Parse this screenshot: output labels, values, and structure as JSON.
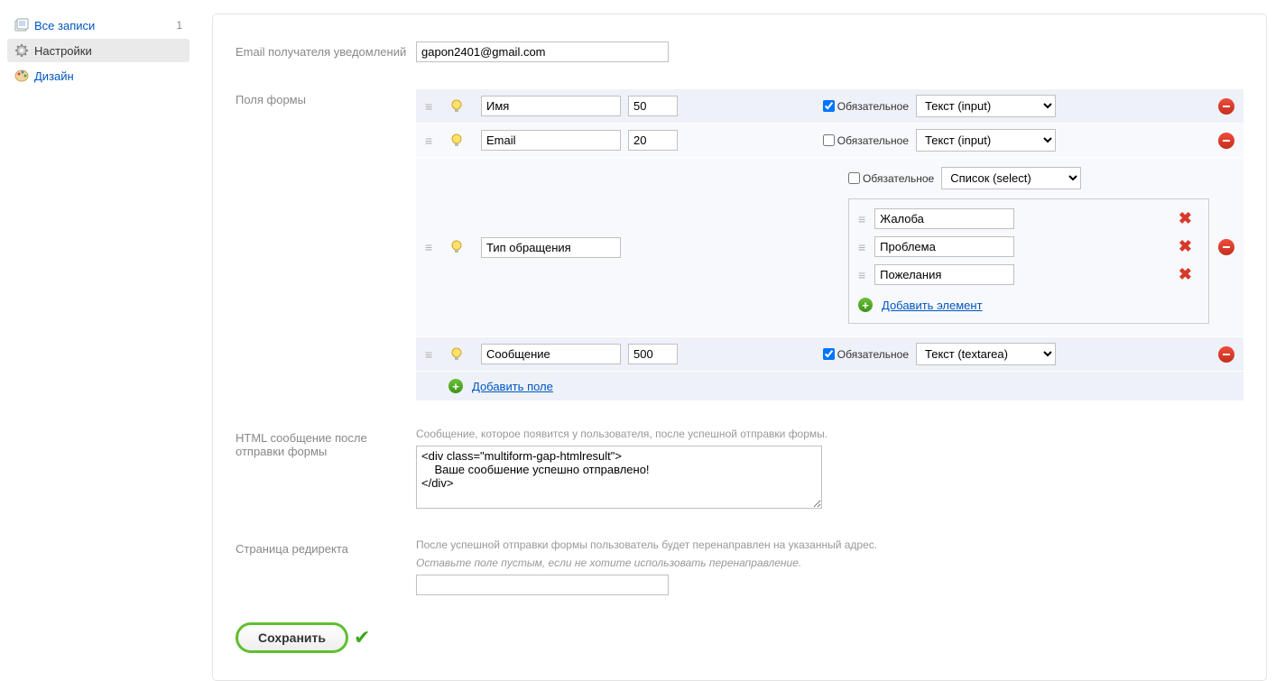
{
  "sidebar": {
    "items": [
      {
        "label": "Все записи",
        "count": "1"
      },
      {
        "label": "Настройки"
      },
      {
        "label": "Дизайн"
      }
    ]
  },
  "labels": {
    "email_recipient": "Email получателя уведомлений",
    "form_fields": "Поля формы",
    "required": "Обязательное",
    "add_field": "Добавить поле",
    "add_option": "Добавить элемент",
    "html_msg_label": "HTML сообщение после отправки формы",
    "html_msg_hint": "Сообщение, которое появится у пользователя, после успешной отправки формы.",
    "redirect_label": "Страница редиректа",
    "redirect_hint1": "После успешной отправки формы пользователь будет перенаправлен на указанный адрес.",
    "redirect_hint2": "Оставьте поле пустым, если не хотите использовать перенаправление.",
    "save": "Сохранить"
  },
  "values": {
    "email": "gapon2401@gmail.com",
    "html_msg": "<div class=\"multiform-gap-htmlresult\">\n    Ваше сообшение успешно отправлено!\n</div>",
    "redirect": ""
  },
  "field_types": {
    "text_input": "Текст (input)",
    "select": "Список (select)",
    "textarea": "Текст (textarea)"
  },
  "fields": [
    {
      "name": "Имя",
      "size": "50",
      "required": true,
      "type": "text_input"
    },
    {
      "name": "Email",
      "size": "20",
      "required": false,
      "type": "text_input"
    },
    {
      "name": "Тип обращения",
      "size": "",
      "required": false,
      "type": "select",
      "options": [
        "Жалоба",
        "Проблема",
        "Пожелания"
      ]
    },
    {
      "name": "Сообщение",
      "size": "500",
      "required": true,
      "type": "textarea"
    }
  ]
}
